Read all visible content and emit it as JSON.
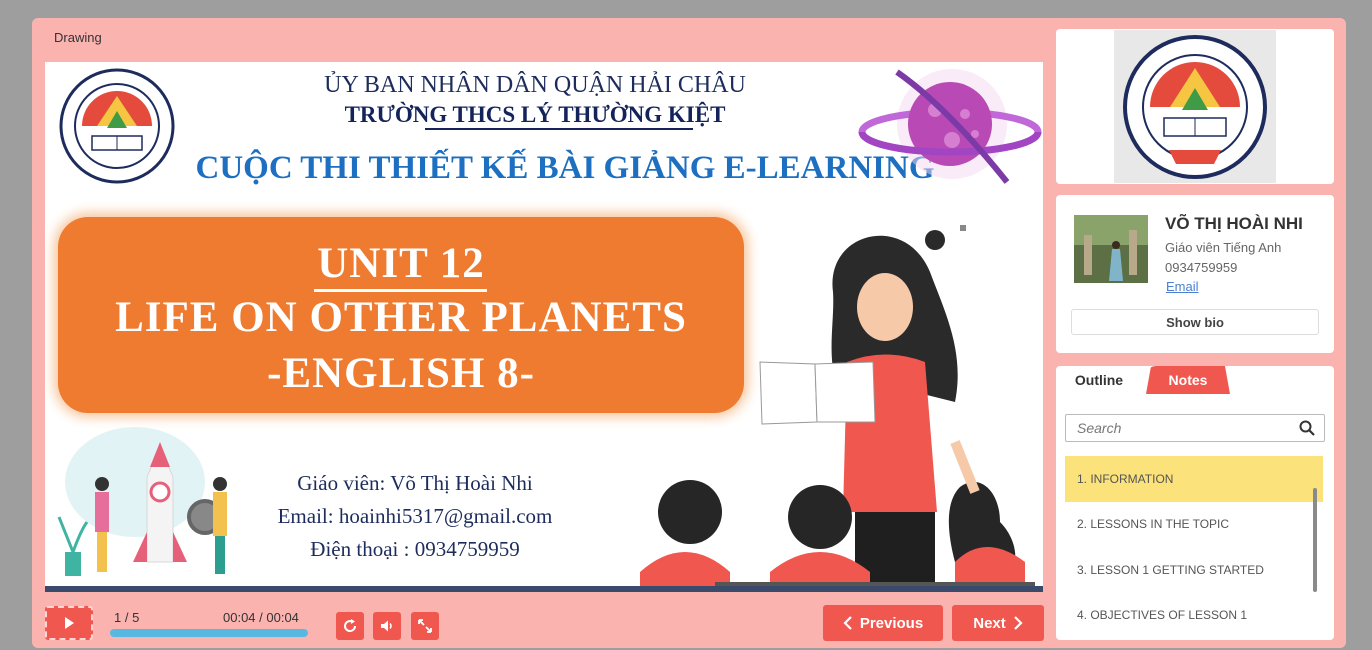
{
  "player": {
    "frame_label": "Drawing"
  },
  "slide": {
    "header_line1": "ỦY BAN NHÂN DÂN QUẬN HẢI CHÂU",
    "header_line2": "TRƯỜNG THCS LÝ THƯỜNG KIỆT",
    "contest_title": "CUỘC THI THIẾT KẾ BÀI GIẢNG E-LEARNING",
    "unit_title": "UNIT 12",
    "unit_subtitle": "LIFE ON OTHER PLANETS",
    "course": "-ENGLISH 8-",
    "teacher_line": "Giáo viên: Võ Thị Hoài Nhi",
    "email_line": "Email: hoainhi5317@gmail.com",
    "phone_line": "Điện thoại : 0934759959",
    "logo_text_top": "TRƯỜNG THCS LÝ THƯỜNG KIỆT",
    "logo_text_bottom": "ĐÀ NẴNG"
  },
  "controls": {
    "slide_counter": "1 / 5",
    "time": "00:04 / 00:04",
    "progress_percent": 100,
    "previous_label": "Previous",
    "next_label": "Next"
  },
  "presenter": {
    "name": "VÕ THỊ HOÀI NHI",
    "role": "Giáo viên Tiếng Anh",
    "phone": "0934759959",
    "email_label": "Email",
    "bio_button": "Show bio"
  },
  "sidebar": {
    "tabs": [
      {
        "label": "Outline"
      },
      {
        "label": "Notes"
      }
    ],
    "search_placeholder": "Search",
    "outline_items": [
      {
        "label": "1. INFORMATION",
        "active": true
      },
      {
        "label": "2. LESSONS IN THE TOPIC"
      },
      {
        "label": "3. LESSON 1 GETTING STARTED"
      },
      {
        "label": "4. OBJECTIVES OF LESSON 1"
      }
    ]
  },
  "colors": {
    "frame": "#fbb3b0",
    "accent": "#f0584f",
    "title_box": "#ee7b30",
    "active_outline": "#fbe27a",
    "progress": "#57b9e2"
  },
  "icons": {
    "play": "play-icon",
    "replay": "replay-icon",
    "volume": "volume-icon",
    "fullscreen": "fullscreen-icon",
    "previous": "chevron-left-icon",
    "next": "chevron-right-icon",
    "search": "search-icon"
  }
}
